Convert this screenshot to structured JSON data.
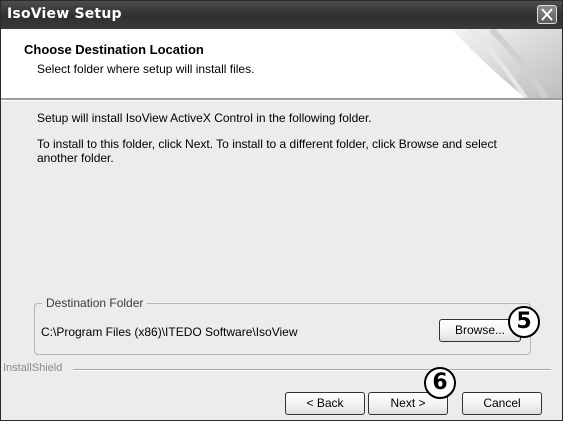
{
  "window": {
    "title": "IsoView Setup"
  },
  "header": {
    "title": "Choose Destination Location",
    "subtitle": "Select folder where setup will install files."
  },
  "body": {
    "line1": "Setup will install IsoView ActiveX Control in the following folder.",
    "line2": "To install to this folder, click Next. To install to a different folder, click Browse and select another folder."
  },
  "destination": {
    "legend": "Destination Folder",
    "path": "C:\\Program Files (x86)\\ITEDO Software\\IsoView",
    "browse_label": "Browse..."
  },
  "footer": {
    "brand": "InstallShield",
    "back_label": "< Back",
    "next_label": "Next >",
    "cancel_label": "Cancel"
  },
  "callouts": {
    "browse": "5",
    "next": "6"
  },
  "icons": {
    "close": "close-icon",
    "header_graphic": "page-curl-icon"
  }
}
